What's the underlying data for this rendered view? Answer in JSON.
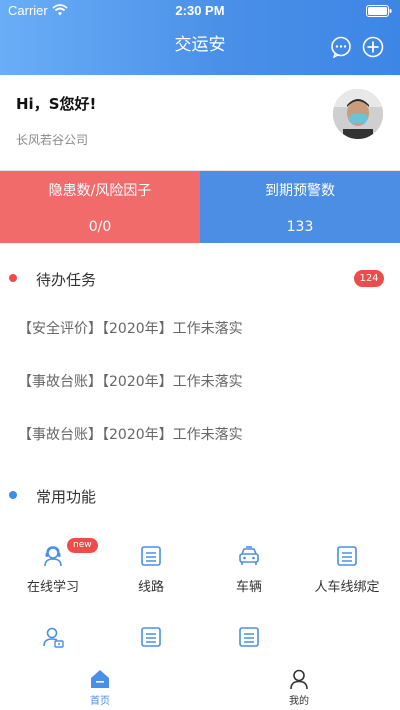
{
  "status_bar": {
    "carrier": "Carrier",
    "time": "2:30 PM"
  },
  "header": {
    "title": "交运安",
    "chat_icon": "chat-bubble-icon",
    "add_icon": "plus-circle-icon"
  },
  "profile": {
    "greeting": "Hi，S您好!",
    "company": "长风若谷公司"
  },
  "stats": [
    {
      "label": "隐患数/风险因子",
      "value": "0/0",
      "color": "#f16b6b"
    },
    {
      "label": "到期预警数",
      "value": "133",
      "color": "#4c8ee4"
    }
  ],
  "todo": {
    "title": "待办任务",
    "count": "124",
    "items": [
      "【安全评价】【2020年】工作未落实",
      "【事故台账】【2020年】工作未落实",
      "【事故台账】【2020年】工作未落实"
    ]
  },
  "functions": {
    "title": "常用功能",
    "items": [
      {
        "label": "在线学习",
        "icon": "online-learning-icon",
        "badge": "new"
      },
      {
        "label": "线路",
        "icon": "route-icon"
      },
      {
        "label": "车辆",
        "icon": "vehicle-icon"
      },
      {
        "label": "人车线绑定",
        "icon": "binding-icon"
      },
      {
        "label": "",
        "icon": "person-card-icon"
      },
      {
        "label": "",
        "icon": "document-icon"
      },
      {
        "label": "",
        "icon": "document-icon"
      }
    ]
  },
  "tabbar": {
    "items": [
      {
        "label": "首页",
        "icon": "home-icon",
        "active": true
      },
      {
        "label": "我的",
        "icon": "profile-icon",
        "active": false
      }
    ]
  },
  "colors": {
    "accent": "#4a8fe6",
    "danger": "#f16b6b",
    "badge": "#ef4b4b"
  }
}
